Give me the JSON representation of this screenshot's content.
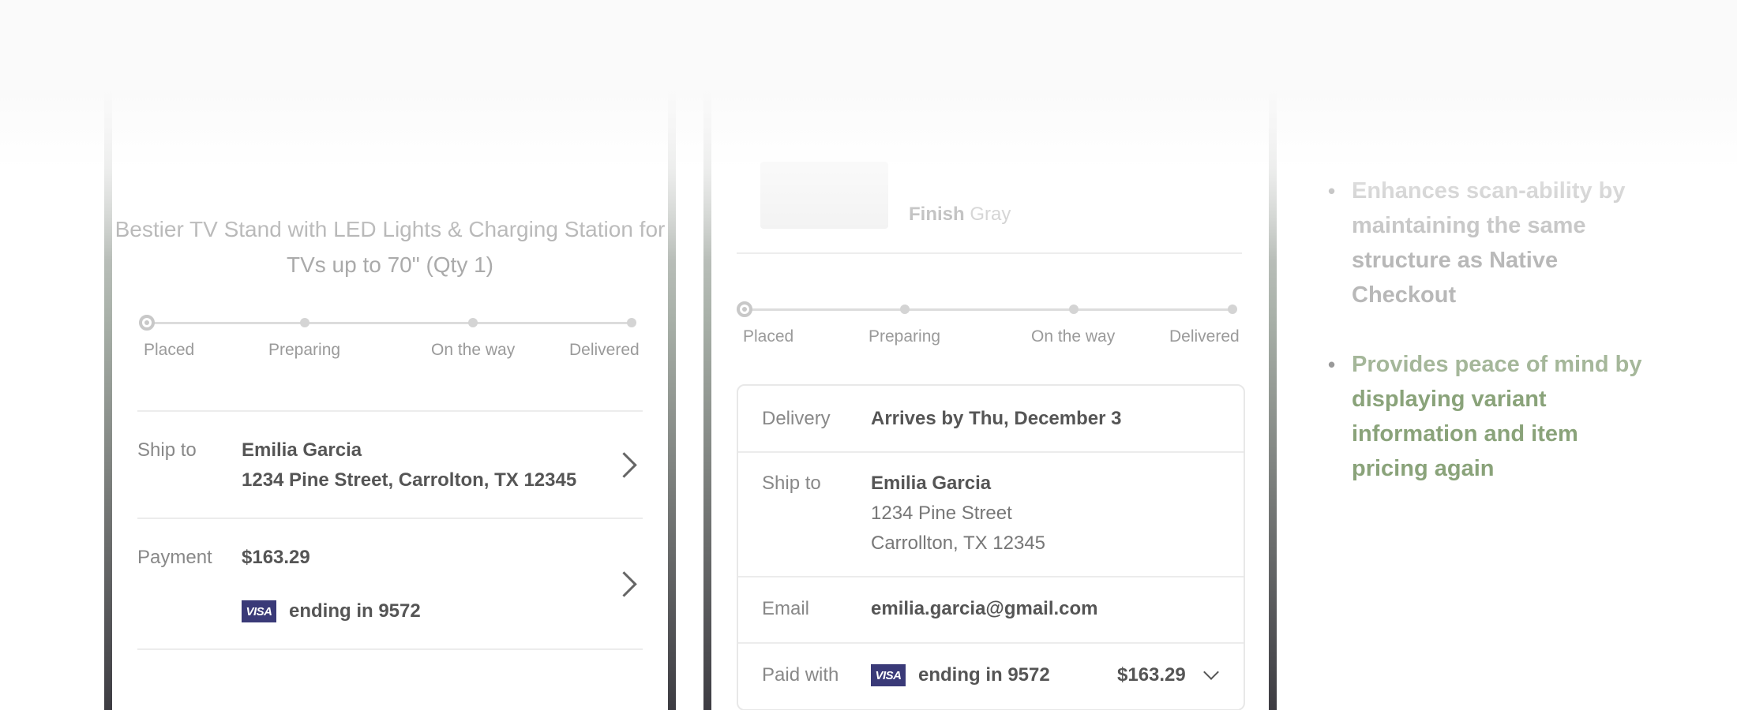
{
  "screen1": {
    "product_title": "Bestier TV Stand with LED Lights & Charging Station for TVs up to 70\" (Qty 1)",
    "tracker": [
      "Placed",
      "Preparing",
      "On the way",
      "Delivered"
    ],
    "ship_to_label": "Ship to",
    "ship_name": "Emilia Garcia",
    "ship_address": "1234 Pine Street, Carrolton, TX 12345",
    "payment_label": "Payment",
    "payment_amount": "$163.29",
    "card_brand": "VISA",
    "card_text": "ending in 9572"
  },
  "screen2": {
    "finish_label": "Finish",
    "finish_value": "Gray",
    "tracker": [
      "Placed",
      "Preparing",
      "On the way",
      "Delivered"
    ],
    "delivery_label": "Delivery",
    "delivery_value": "Arrives by Thu, December 3",
    "ship_to_label": "Ship to",
    "ship_name": "Emilia Garcia",
    "ship_street": "1234 Pine Street",
    "ship_city": "Carrollton, TX 12345",
    "email_label": "Email",
    "email_value": "emilia.garcia@gmail.com",
    "paid_label": "Paid with",
    "card_brand": "VISA",
    "card_text": "ending in 9572",
    "paid_amount": "$163.29"
  },
  "bullets": {
    "b1": "Enhances scan-ability by maintaining the same structure as Native Checkout",
    "b2_lead": "Provides peace of mind by",
    "b2_rest": "displaying variant information and item pricing again"
  },
  "colors": {
    "visa": "#3a3a78",
    "accent_green": "#8aa37a"
  }
}
